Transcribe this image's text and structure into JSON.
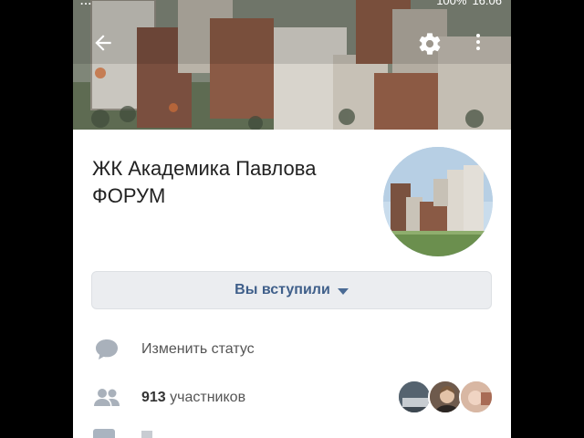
{
  "status_bar": {
    "left_text": "...",
    "battery": "100%",
    "time": "16:06"
  },
  "toolbar": {
    "back_icon": "arrow-left-icon",
    "settings_icon": "gear-icon",
    "more_icon": "more-vertical-icon"
  },
  "group": {
    "title": "ЖК Академика Павлова ФОРУМ"
  },
  "join_button": {
    "label": "Вы вступили"
  },
  "rows": {
    "status_label": "Изменить статус",
    "members_count": "913",
    "members_label": "участников"
  },
  "colors": {
    "accent": "#3f5f8a",
    "button_bg": "#ebedf0",
    "icon_gray": "#a9b1bb"
  }
}
